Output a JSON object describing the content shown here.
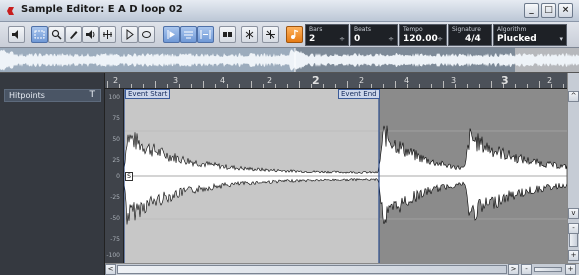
{
  "window": {
    "title": "Sample Editor: E A D loop 02",
    "minimize_label": "_",
    "maximize_label": "□",
    "close_label": "×"
  },
  "toolbar": {
    "infoline": [
      {
        "label": "Bars",
        "value": "2"
      },
      {
        "label": "Beats",
        "value": "0"
      },
      {
        "label": "Tempo",
        "value": "120.00"
      },
      {
        "label": "Signature",
        "value": "4/4"
      },
      {
        "label": "Algorithm",
        "value": "Plucked"
      }
    ]
  },
  "sidebar": {
    "hitpoints_label": "Hitpoints",
    "hitpoints_icon_glyph": "T"
  },
  "ruler": {
    "beat_labels": [
      "2",
      "3",
      "4",
      "2",
      "2",
      "3",
      "4",
      "3",
      "2"
    ],
    "bar_labels": [
      "2",
      "3"
    ]
  },
  "waveform": {
    "level_labels": [
      "100",
      "75",
      "50",
      "25",
      "0",
      "-25",
      "-50",
      "-75",
      "-100"
    ],
    "event_start_label": "Event Start",
    "event_end_label": "Event End",
    "sync_marker_label": "S"
  },
  "scrollbar": {
    "left_arrow": "<",
    "right_arrow": ">",
    "up_arrow": "^",
    "down_arrow": "v",
    "zoom_minus": "-",
    "zoom_plus": "+"
  },
  "colors": {
    "event_region": "#c7c7c7",
    "outside_region": "#8b8b8b",
    "accent_blue": "#3b5b98",
    "orange_button": "#e67a14"
  }
}
